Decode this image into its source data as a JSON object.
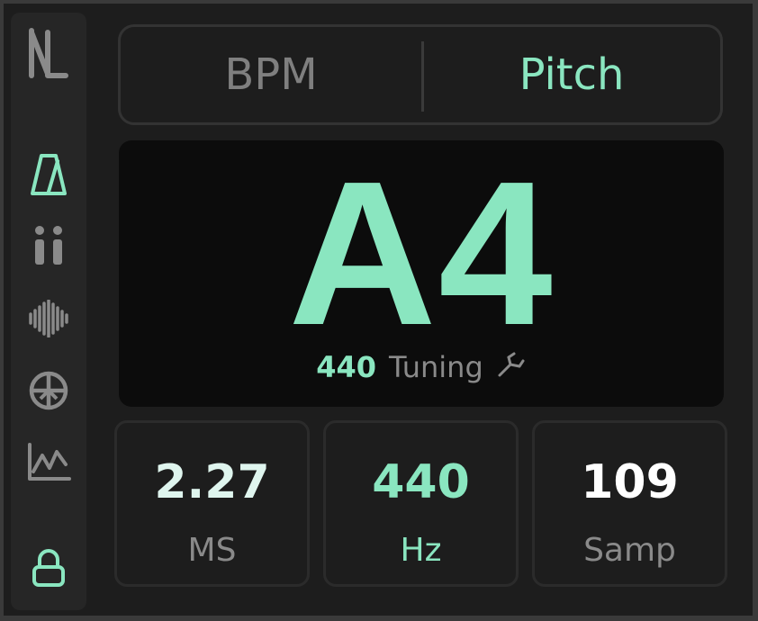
{
  "tabs": {
    "bpm": "BPM",
    "pitch": "Pitch",
    "active": "Pitch"
  },
  "display": {
    "note": "A4",
    "tuning_value": "440",
    "tuning_label": "Tuning"
  },
  "cards": [
    {
      "value": "2.27",
      "unit": "MS",
      "value_color": "#dff5ee",
      "unit_color": "#8a8a8a"
    },
    {
      "value": "440",
      "unit": "Hz",
      "value_color": "#8ae6c0",
      "unit_color": "#8ae6c0"
    },
    {
      "value": "109",
      "unit": "Samp",
      "value_color": "#ffffff",
      "unit_color": "#8a8a8a"
    }
  ],
  "sidebar": {
    "icons": [
      "logo-icon",
      "metronome-icon",
      "pause-icon",
      "waveform-icon",
      "crosshair-icon",
      "line-chart-icon",
      "lock-icon"
    ]
  },
  "colors": {
    "accent": "#8ae6c0",
    "muted": "#7f7f7f",
    "background": "#1d1d1d",
    "display_bg": "#0c0c0c"
  }
}
